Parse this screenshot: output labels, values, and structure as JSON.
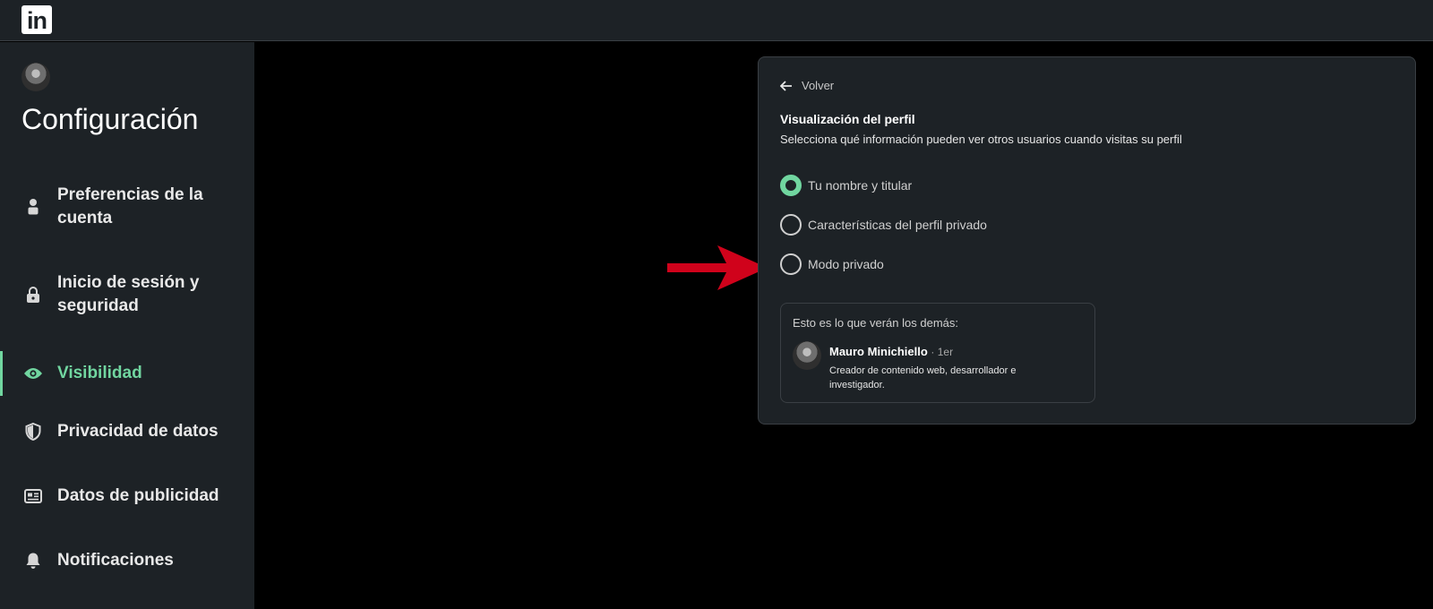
{
  "topbar": {
    "logo_text": "in"
  },
  "sidebar": {
    "title": "Configuración",
    "active_color": "#71d6a0",
    "items": [
      {
        "label": "Preferencias de la cuenta",
        "icon": "person-icon"
      },
      {
        "label": "Inicio de sesión y seguridad",
        "icon": "lock-icon"
      },
      {
        "label": "Visibilidad",
        "icon": "eye-icon",
        "active": true
      },
      {
        "label": "Privacidad de datos",
        "icon": "shield-icon"
      },
      {
        "label": "Datos de publicidad",
        "icon": "newspaper-icon"
      },
      {
        "label": "Notificaciones",
        "icon": "bell-icon"
      }
    ]
  },
  "panel": {
    "back_label": "Volver",
    "title": "Visualización del perfil",
    "subtitle": "Selecciona qué información pueden ver otros usuarios cuando visitas su perfil",
    "options": [
      {
        "label": "Tu nombre y titular",
        "selected": true
      },
      {
        "label": "Características del perfil privado",
        "selected": false
      },
      {
        "label": "Modo privado",
        "selected": false
      }
    ],
    "preview": {
      "caption": "Esto es lo que verán los demás:",
      "name": "Mauro Minichiello",
      "degree": "· 1er",
      "headline": "Creador de contenido web, desarrollador e investigador."
    }
  },
  "annotation": {
    "arrow_color": "#d0021b",
    "arrow_icon": "red-arrow-right-icon"
  }
}
